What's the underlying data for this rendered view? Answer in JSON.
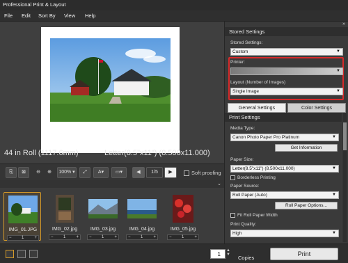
{
  "window": {
    "title": "Professional Print & Layout"
  },
  "menu": [
    "File",
    "Edit",
    "Sort By",
    "View",
    "Help"
  ],
  "preview": {
    "roll_info": "44 in Roll (1117.6mm)",
    "paper_info": "Letter(8.5\"x11\") (8.500x11.000)"
  },
  "toolbar": {
    "zoom": "100%",
    "page": "1/5",
    "soft_proofing": "Soft proofing"
  },
  "thumbnails": [
    {
      "name": "IMG_01.JPG",
      "count": "1",
      "selected": true
    },
    {
      "name": "IMG_02.jpg",
      "count": "1",
      "selected": false
    },
    {
      "name": "IMG_03.jpg",
      "count": "1",
      "selected": false
    },
    {
      "name": "IMG_04.jpg",
      "count": "1",
      "selected": false
    },
    {
      "name": "IMG_05.jpg",
      "count": "1",
      "selected": false
    }
  ],
  "bottom": {
    "copies_value": "1",
    "copies_label": "Copies",
    "print_label": "Print"
  },
  "sidebar": {
    "stored_settings_header": "Stored Settings",
    "stored_settings_label": "Stored Settings:",
    "stored_settings_value": "Custom",
    "printer_label": "Printer:",
    "printer_value": "",
    "layout_label": "Layout (Number of Images)",
    "layout_value": "Single Image",
    "tab_general": "General Settings",
    "tab_color": "Color Settings",
    "print_settings_header": "Print Settings",
    "media_type_label": "Media Type:",
    "media_type_value": "Canon Photo Paper Pro Platinum",
    "get_information": "Get Information",
    "paper_size_label": "Paper Size:",
    "paper_size_value": "Letter(8.5\"x11\") (8.500x11.000)",
    "borderless": "Borderless Printing",
    "paper_source_label": "Paper Source:",
    "paper_source_value": "Roll Paper (Auto)",
    "roll_paper_options": "Roll Paper Options...",
    "fit_roll": "Fit Roll Paper Width",
    "print_quality_label": "Print Quality:",
    "print_quality_value": "High"
  }
}
